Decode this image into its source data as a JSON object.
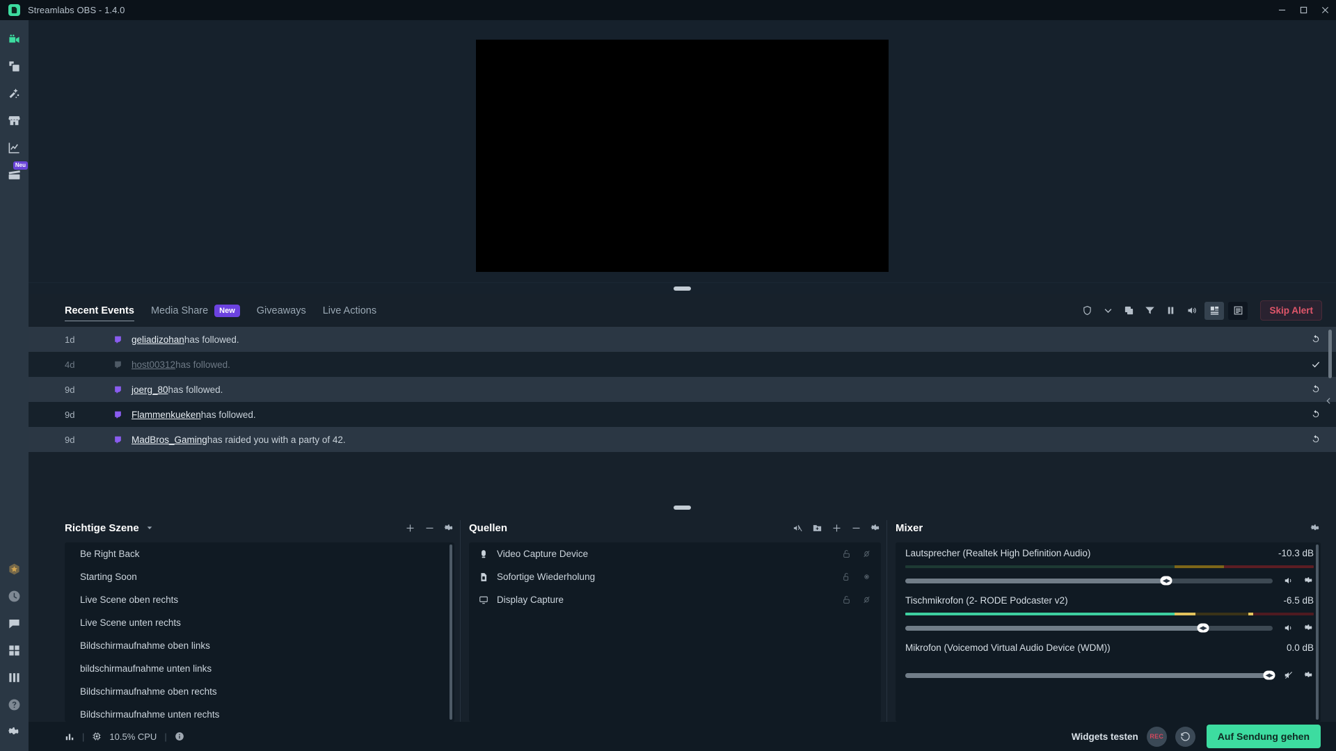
{
  "window": {
    "title": "Streamlabs OBS - 1.4.0",
    "icon": "streamlabs-logo-icon",
    "controls": {
      "minimize": "minimize-icon",
      "maximize": "maximize-icon",
      "close": "close-icon"
    },
    "accent_green": "#3ddca0",
    "accent_purple": "#6c42e0",
    "accent_red": "#e0566a"
  },
  "leftnav": {
    "top_items": [
      {
        "name": "editor",
        "icon": "video-camera-icon",
        "active": true
      },
      {
        "name": "themes",
        "icon": "layers-icon",
        "active": false
      },
      {
        "name": "alertbox",
        "icon": "magic-wand-icon",
        "active": false
      },
      {
        "name": "store",
        "icon": "store-icon",
        "active": false
      },
      {
        "name": "dashboard",
        "icon": "chart-line-icon",
        "active": false
      },
      {
        "name": "highlighter",
        "icon": "clapperboard-icon",
        "active": false,
        "badge": "Neu"
      }
    ],
    "bottom_items": [
      {
        "name": "prime",
        "icon": "prime-star-icon",
        "active": false
      },
      {
        "name": "recent",
        "icon": "clock-icon",
        "active": false
      },
      {
        "name": "chat",
        "icon": "chat-bubble-icon",
        "active": false
      },
      {
        "name": "layout",
        "icon": "grid-icon",
        "active": false
      },
      {
        "name": "columns",
        "icon": "columns-icon",
        "active": false
      },
      {
        "name": "help",
        "icon": "help-circle-icon",
        "active": false
      },
      {
        "name": "settings",
        "icon": "gear-icon",
        "active": false
      }
    ]
  },
  "events": {
    "tabs": [
      {
        "label": "Recent Events",
        "active": true
      },
      {
        "label": "Media Share",
        "active": false,
        "badge": "New"
      },
      {
        "label": "Giveaways",
        "active": false
      },
      {
        "label": "Live Actions",
        "active": false
      }
    ],
    "actions": [
      {
        "name": "shield-icon"
      },
      {
        "name": "chevron-down-icon"
      },
      {
        "name": "layers-icon"
      },
      {
        "name": "filter-icon"
      },
      {
        "name": "pause-icon"
      },
      {
        "name": "speaker-icon"
      }
    ],
    "view_toggles": [
      {
        "name": "view-compact-icon",
        "selected": true
      },
      {
        "name": "view-list-icon",
        "selected": false
      }
    ],
    "skip_alert_label": "Skip Alert",
    "rows": [
      {
        "time": "1d",
        "platform": "twitch-icon",
        "user": "geliadizohan",
        "text": " has followed.",
        "action": "replay-icon",
        "read": false
      },
      {
        "time": "4d",
        "platform": "twitch-icon",
        "user": "host00312",
        "text": " has followed.",
        "action": "check-icon",
        "read": true
      },
      {
        "time": "9d",
        "platform": "twitch-icon",
        "user": "joerg_80",
        "text": " has followed.",
        "action": "replay-icon",
        "read": false
      },
      {
        "time": "9d",
        "platform": "twitch-icon",
        "user": "Flammenkueken",
        "text": " has followed.",
        "action": "replay-icon",
        "read": false
      },
      {
        "time": "9d",
        "platform": "twitch-icon",
        "user": "MadBros_Gaming",
        "text": " has raided you with a party of 42.",
        "action": "replay-icon",
        "read": false
      }
    ]
  },
  "scenes": {
    "title": "Richtige Szene",
    "caret": "chevron-down-icon",
    "actions": [
      {
        "name": "add-scene-icon",
        "glyph": "plus"
      },
      {
        "name": "remove-scene-icon",
        "glyph": "minus"
      },
      {
        "name": "scene-settings-icon",
        "glyph": "gear"
      }
    ],
    "items": [
      {
        "label": "Be Right Back"
      },
      {
        "label": "Starting Soon"
      },
      {
        "label": "Live Scene oben rechts"
      },
      {
        "label": "Live Scene unten rechts"
      },
      {
        "label": "Bildschirmaufnahme oben links"
      },
      {
        "label": "bildschirmaufnahme unten links"
      },
      {
        "label": "Bildschirmaufnahme oben rechts"
      },
      {
        "label": "Bildschirmaufnahme unten rechts"
      }
    ]
  },
  "sources": {
    "title": "Quellen",
    "actions": [
      {
        "name": "audio-mix-icon"
      },
      {
        "name": "add-folder-icon"
      },
      {
        "name": "add-source-icon",
        "glyph": "plus"
      },
      {
        "name": "remove-source-icon",
        "glyph": "minus"
      },
      {
        "name": "source-settings-icon",
        "glyph": "gear"
      }
    ],
    "items": [
      {
        "label": "Video Capture Device",
        "icon": "camera-icon",
        "lock": "unlocked-icon",
        "visibility": "eye-slash-icon"
      },
      {
        "label": "Sofortige Wiederholung",
        "icon": "file-icon",
        "lock": "unlocked-icon",
        "visibility": "eye-icon"
      },
      {
        "label": "Display Capture",
        "icon": "monitor-icon",
        "lock": "unlocked-icon",
        "visibility": "eye-slash-icon"
      }
    ]
  },
  "mixer": {
    "title": "Mixer",
    "settings_icon": "gear-icon",
    "channels": [
      {
        "name": "Lautsprecher (Realtek High Definition Audio)",
        "db": "-10.3 dB",
        "level_pct": 0,
        "volume_pct": 71,
        "muted": false,
        "mute_icon": "speaker-icon",
        "settings_icon": "gear-icon"
      },
      {
        "name": "Tischmikrofon (2- RODE Podcaster v2)",
        "db": "-6.5 dB",
        "level_pct": 68,
        "volume_pct": 81,
        "muted": false,
        "mute_icon": "speaker-icon",
        "settings_icon": "gear-icon"
      },
      {
        "name": "Mikrofon (Voicemod Virtual Audio Device (WDM))",
        "db": "0.0 dB",
        "level_pct": 0,
        "volume_pct": 100,
        "muted": true,
        "mute_icon": "speaker-mute-icon",
        "settings_icon": "gear-icon"
      }
    ]
  },
  "statusbar": {
    "stats_icon": "bar-chart-icon",
    "cpu_icon": "cpu-chip-icon",
    "cpu_label": "10.5% CPU",
    "info_icon": "info-circle-icon",
    "widgets_test_label": "Widgets testen",
    "record_label": "REC",
    "replay_icon": "replay-buffer-icon",
    "golive_label": "Auf Sendung gehen"
  }
}
